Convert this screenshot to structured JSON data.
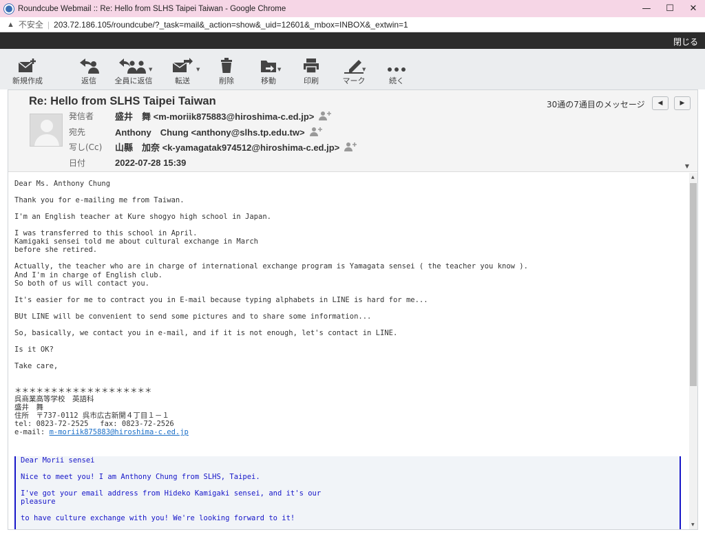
{
  "window": {
    "title": "Roundcube Webmail :: Re: Hello from SLHS Taipei Taiwan - Google Chrome",
    "controls": [
      "—",
      "☐",
      "✕"
    ]
  },
  "address_bar": {
    "security": "不安全",
    "url": "203.72.186.105/roundcube/?_task=mail&_action=show&_uid=12601&_mbox=INBOX&_extwin=1"
  },
  "topbar": {
    "close_label": "閉じる"
  },
  "toolbar": {
    "compose": "新規作成",
    "reply": "返信",
    "reply_all": "全員に返信",
    "forward": "転送",
    "delete": "削除",
    "move": "移動",
    "print": "印刷",
    "mark": "マーク",
    "more": "続く"
  },
  "message": {
    "subject": "Re: Hello from SLHS Taipei Taiwan",
    "counter": "30通の7通目のメッセージ",
    "headers": {
      "from_label": "発信者",
      "from": "盛井　舞 <m-moriik875883@hiroshima-c.ed.jp>",
      "to_label": "宛先",
      "to": "Anthony　Chung <anthony@slhs.tp.edu.tw>",
      "cc_label": "写し(Cc)",
      "cc": "山縣　加奈 <k-yamagatak974512@hiroshima-c.ed.jp>",
      "date_label": "日付",
      "date": "2022-07-28 15:39"
    },
    "body": "Dear Ms. Anthony Chung\n\nThank you for e-mailing me from Taiwan.\n\nI'm an English teacher at Kure shogyo high school in Japan.\n\nI was transferred to this school in April.\nKamigaki sensei told me about cultural exchange in March\nbefore she retired.\n\nActually, the teacher who are in charge of international exchange program is Yamagata sensei ( the teacher you know ).\nAnd I'm in charge of English club.\nSo both of us will contact you.\n\nIt's easier for me to contract you in E-mail because typing alphabets in LINE is hard for me...\n\nBUt LINE will be convenient to send some pictures and to share some information...\n\nSo, basically, we contact you in e-mail, and if it is not enough, let's contact in LINE.\n\nIs it OK?\n\nTake care,\n\n\n＊＊＊＊＊＊＊＊＊＊＊＊＊＊＊＊＊＊＊\n呉商業高等学校　英語科\n盛井　舞\n住所　〒737-0112 呉市広古新開４丁目１－１\ntel: 0823-72-2525　 fax: 0823-72-2526\ne-mail: ",
    "signature_email": "m-moriik875883@hiroshima-c.ed.jp",
    "quoted": "Dear Morii sensei\n\nNice to meet you! I am Anthony Chung from SLHS, Taipei.\n\nI've got your email address from Hideko Kamigaki sensei, and it's our\npleasure\n\nto have culture exchange with you! We're looking forward to it!"
  },
  "colors": {
    "titlebar": "#f6d6e6",
    "topbar": "#2c2c2c",
    "toolbar": "#ebedef",
    "link": "#1a6ec7",
    "quote": "#1515c8"
  }
}
